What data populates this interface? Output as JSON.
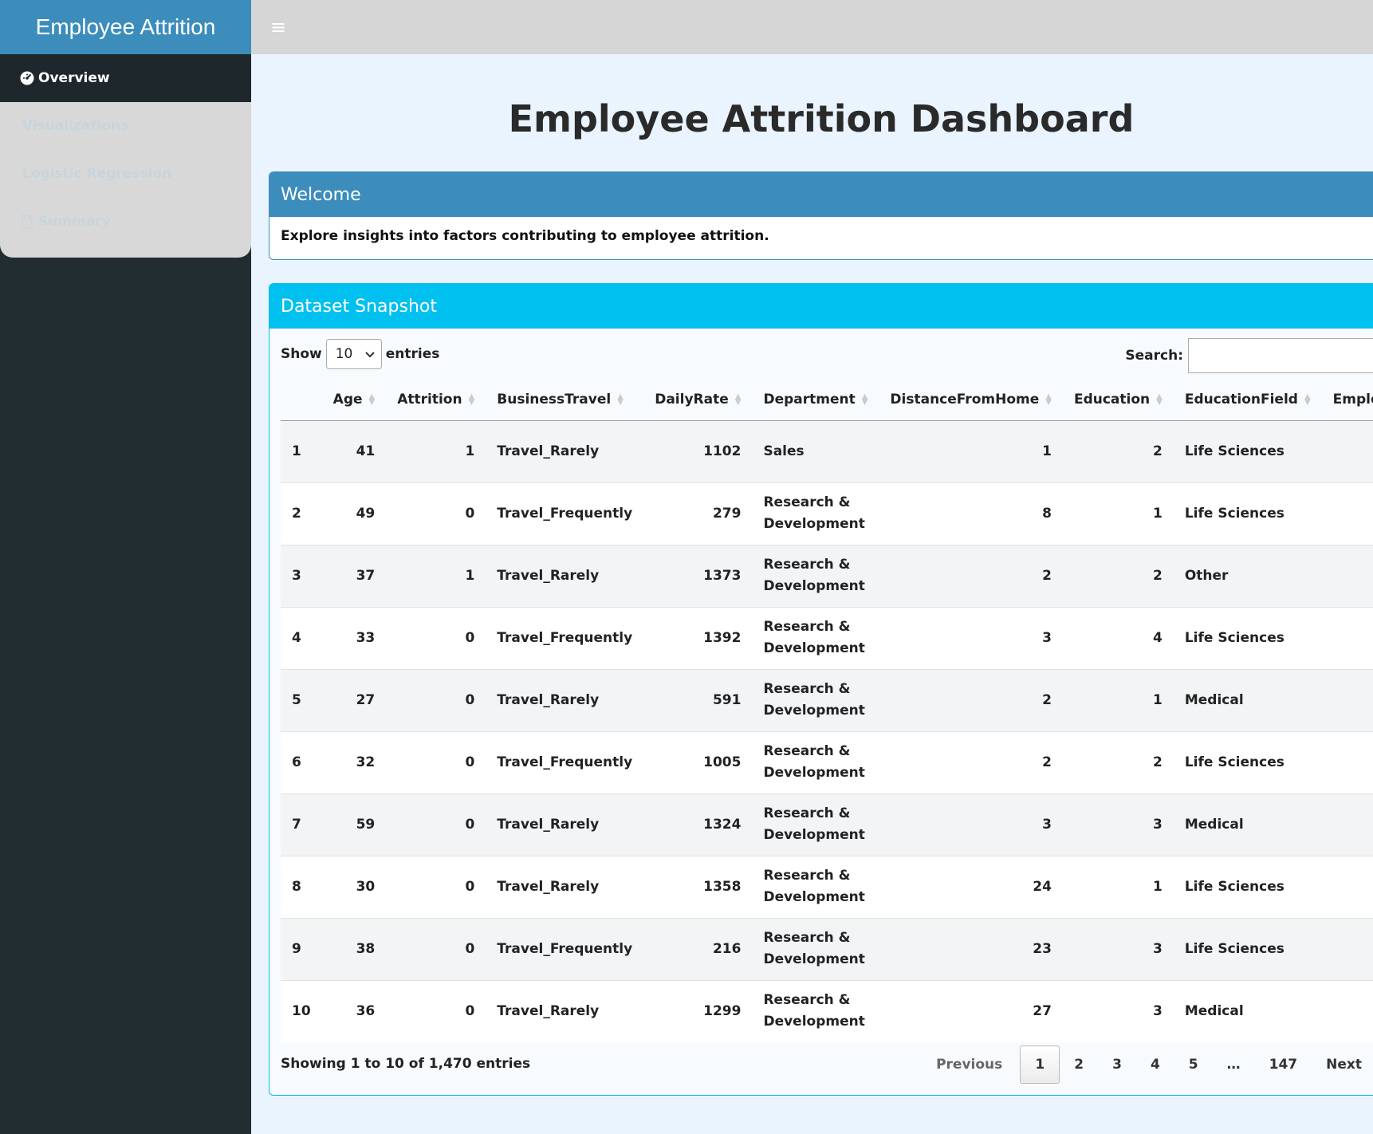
{
  "app": {
    "brand": "Employee Attrition"
  },
  "sidebar": {
    "items": [
      {
        "label": "Overview",
        "icon": "dashboard-icon",
        "active": true
      },
      {
        "label": "Visualizations"
      },
      {
        "label": "Logistic Regression"
      },
      {
        "label": "Summary",
        "icon": "file-icon"
      }
    ]
  },
  "page": {
    "title": "Employee Attrition Dashboard"
  },
  "welcome": {
    "title": "Welcome",
    "text": "Explore insights into factors contributing to employee attrition."
  },
  "snapshot": {
    "title": "Dataset Snapshot",
    "show_label": "Show",
    "entries_value": "10",
    "entries_label": "entries",
    "search_label": "Search:",
    "search_value": "",
    "columns": [
      "",
      "Age",
      "Attrition",
      "BusinessTravel",
      "DailyRate",
      "Department",
      "DistanceFromHome",
      "Education",
      "EducationField",
      "EmployeeCou"
    ],
    "rows": [
      [
        "1",
        "41",
        "1",
        "Travel_Rarely",
        "1102",
        "Sales",
        "1",
        "2",
        "Life Sciences"
      ],
      [
        "2",
        "49",
        "0",
        "Travel_Frequently",
        "279",
        "Research & Development",
        "8",
        "1",
        "Life Sciences"
      ],
      [
        "3",
        "37",
        "1",
        "Travel_Rarely",
        "1373",
        "Research & Development",
        "2",
        "2",
        "Other"
      ],
      [
        "4",
        "33",
        "0",
        "Travel_Frequently",
        "1392",
        "Research & Development",
        "3",
        "4",
        "Life Sciences"
      ],
      [
        "5",
        "27",
        "0",
        "Travel_Rarely",
        "591",
        "Research & Development",
        "2",
        "1",
        "Medical"
      ],
      [
        "6",
        "32",
        "0",
        "Travel_Frequently",
        "1005",
        "Research & Development",
        "2",
        "2",
        "Life Sciences"
      ],
      [
        "7",
        "59",
        "0",
        "Travel_Rarely",
        "1324",
        "Research & Development",
        "3",
        "3",
        "Medical"
      ],
      [
        "8",
        "30",
        "0",
        "Travel_Rarely",
        "1358",
        "Research & Development",
        "24",
        "1",
        "Life Sciences"
      ],
      [
        "9",
        "38",
        "0",
        "Travel_Frequently",
        "216",
        "Research & Development",
        "23",
        "3",
        "Life Sciences"
      ],
      [
        "10",
        "36",
        "0",
        "Travel_Rarely",
        "1299",
        "Research & Development",
        "27",
        "3",
        "Medical"
      ]
    ],
    "info": "Showing 1 to 10 of 1,470 entries",
    "pagination": {
      "previous": "Previous",
      "pages": [
        "1",
        "2",
        "3",
        "4",
        "5",
        "…",
        "147"
      ],
      "current": "1",
      "next": "Next"
    }
  }
}
